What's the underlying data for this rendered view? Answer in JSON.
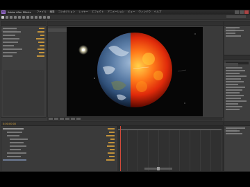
{
  "app": {
    "logo": "Ae",
    "title": "Adobe After Effects",
    "menus": [
      "ファイル",
      "編集",
      "コンポジション",
      "レイヤー",
      "エフェクト",
      "アニメーション",
      "ビュー",
      "ウィンドウ",
      "ヘルプ"
    ]
  },
  "timeline": {
    "timecode": "0:00:00:00"
  },
  "icons": [
    "selection-tool-icon",
    "hand-tool-icon",
    "zoom-tool-icon",
    "rotate-tool-icon",
    "camera-tool-icon",
    "pan-tool-icon",
    "pen-tool-icon",
    "text-tool-icon",
    "brush-tool-icon",
    "clone-tool-icon",
    "eraser-tool-icon",
    "puppet-tool-icon"
  ],
  "colors": {
    "accent": "#d9a23c",
    "playhead": "#d24a3a",
    "panel": "#3e3e3e",
    "background": "#3a3a3a"
  }
}
